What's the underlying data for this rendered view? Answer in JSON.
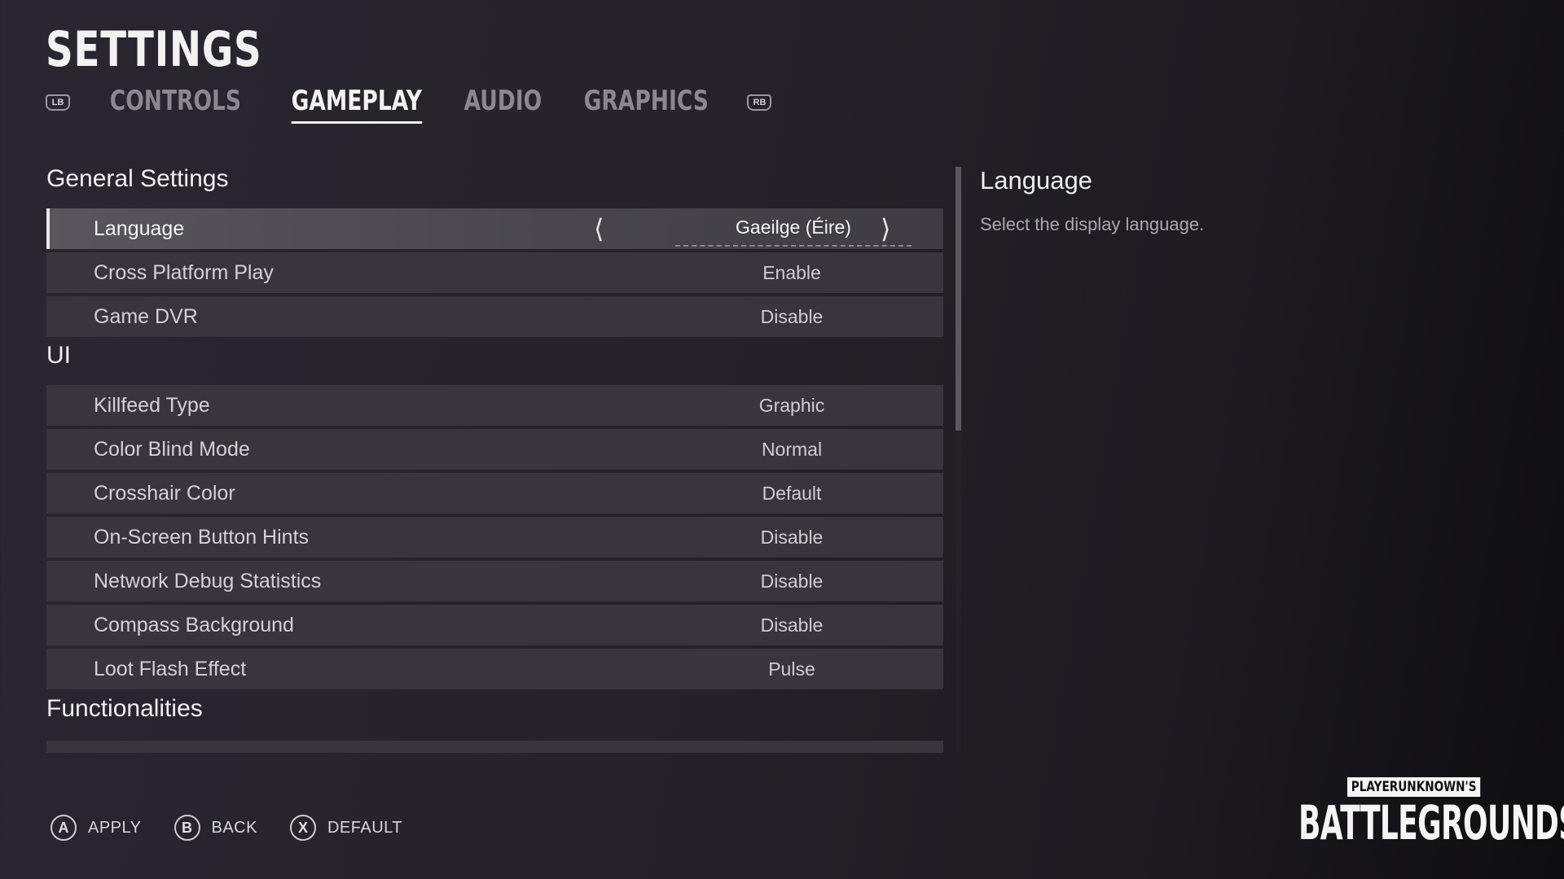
{
  "header": {
    "title": "SETTINGS",
    "left_bumper": "LB",
    "right_bumper": "RB",
    "tabs": [
      {
        "label": "CONTROLS",
        "active": false
      },
      {
        "label": "GAMEPLAY",
        "active": true
      },
      {
        "label": "AUDIO",
        "active": false
      },
      {
        "label": "GRAPHICS",
        "active": false
      }
    ]
  },
  "sections": {
    "general": {
      "title": "General Settings",
      "rows": [
        {
          "label": "Language",
          "value": "Gaeilge (Éire)",
          "selected": true
        },
        {
          "label": "Cross Platform Play",
          "value": "Enable"
        },
        {
          "label": "Game DVR",
          "value": "Disable"
        }
      ]
    },
    "ui": {
      "title": "UI",
      "rows": [
        {
          "label": "Killfeed Type",
          "value": "Graphic"
        },
        {
          "label": "Color Blind Mode",
          "value": "Normal"
        },
        {
          "label": "Crosshair Color",
          "value": "Default"
        },
        {
          "label": "On-Screen Button Hints",
          "value": "Disable"
        },
        {
          "label": "Network Debug Statistics",
          "value": "Disable"
        },
        {
          "label": "Compass Background",
          "value": "Disable"
        },
        {
          "label": "Loot Flash Effect",
          "value": "Pulse"
        }
      ]
    },
    "functionalities": {
      "title": "Functionalities"
    }
  },
  "detail": {
    "title": "Language",
    "description": "Select the display language."
  },
  "footer": {
    "buttons": [
      {
        "glyph": "A",
        "label": "APPLY"
      },
      {
        "glyph": "B",
        "label": "BACK"
      },
      {
        "glyph": "X",
        "label": "DEFAULT"
      }
    ]
  },
  "logo": {
    "top": "PLAYERUNKNOWN'S",
    "main": "BATTLEGROUNDS"
  },
  "scroll": {
    "position": 0.0,
    "visible_fraction": 0.45
  }
}
